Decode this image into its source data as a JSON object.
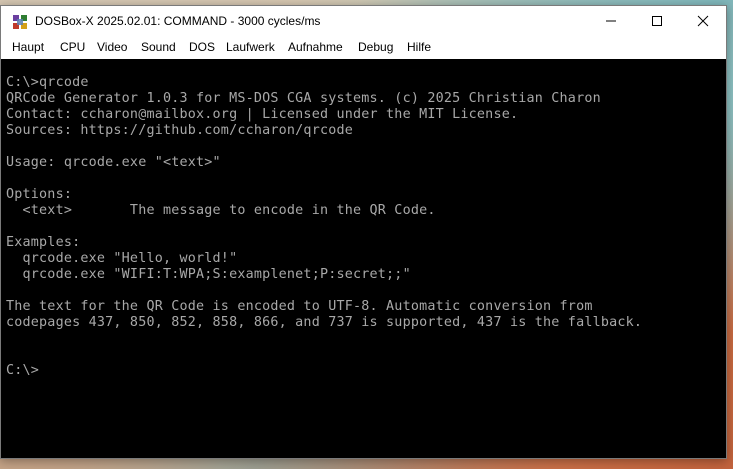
{
  "window": {
    "title": "DOSBox-X 2025.02.01: COMMAND - 3000 cycles/ms",
    "app_icon": "dosbox-x-icon",
    "controls": [
      "minimize-icon",
      "maximize-icon",
      "close-icon"
    ]
  },
  "menu": {
    "items": [
      {
        "label": "Haupt"
      },
      {
        "label": "CPU"
      },
      {
        "label": "Video"
      },
      {
        "label": "Sound"
      },
      {
        "label": "DOS"
      },
      {
        "label": "Laufwerk"
      },
      {
        "label": "Aufnahme"
      },
      {
        "label": "Debug"
      },
      {
        "label": "Hilfe"
      }
    ]
  },
  "console": {
    "text_color": "#a8a8a8",
    "background": "#000000",
    "lines": [
      "C:\\>qrcode",
      "QRCode Generator 1.0.3 for MS-DOS CGA systems. (c) 2025 Christian Charon",
      "Contact: ccharon@mailbox.org | Licensed under the MIT License.",
      "Sources: https://github.com/ccharon/qrcode",
      "",
      "Usage: qrcode.exe \"<text>\"",
      "",
      "Options:",
      "  <text>       The message to encode in the QR Code.",
      "",
      "Examples:",
      "  qrcode.exe \"Hello, world!\"",
      "  qrcode.exe \"WIFI:T:WPA;S:examplenet;P:secret;;\"",
      "",
      "The text for the QR Code is encoded to UTF-8. Automatic conversion from",
      "codepages 437, 850, 852, 858, 866, and 737 is supported, 437 is the fallback.",
      "",
      "",
      "C:\\>"
    ]
  }
}
